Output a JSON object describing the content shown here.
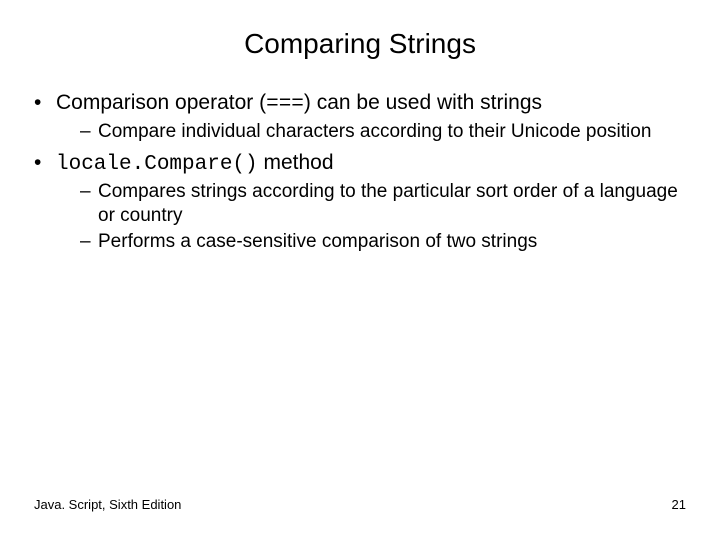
{
  "title": "Comparing Strings",
  "bullets": [
    {
      "pre": "Comparison operator (",
      "code": "===",
      "post": ") can be used with strings",
      "sub": [
        "Compare individual characters according to their Unicode position"
      ]
    },
    {
      "pre": "",
      "code": "locale.Compare()",
      "post": " method",
      "sub": [
        "Compares strings according to the particular sort order of a language or country",
        "Performs a case-sensitive comparison of two strings"
      ]
    }
  ],
  "footer": {
    "left": "Java. Script, Sixth Edition",
    "right": "21"
  }
}
